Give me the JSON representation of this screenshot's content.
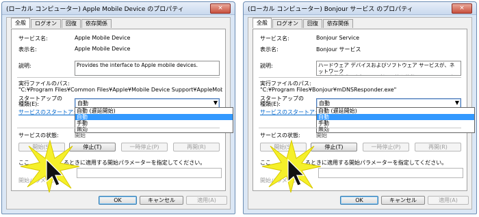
{
  "left": {
    "title": "(ローカル コンピューター) Apple Mobile Device のプロパティ",
    "close_label": "×",
    "tabs": [
      "全般",
      "ログオン",
      "回復",
      "依存関係"
    ],
    "service_name_label": "サービス名:",
    "service_name": "Apple Mobile Device",
    "display_name_label": "表示名:",
    "display_name": "Apple Mobile Device",
    "description_label": "説明:",
    "description": "Provides the interface to Apple mobile devices.",
    "exe_path_label": "実行ファイルのパス:",
    "exe_path": "\"C:¥Program Files¥Common Files¥Apple¥Mobile Device Support¥AppleMobileDev",
    "startup_type_label": "スタートアップの\n種類(E):",
    "startup_type_value": "自動",
    "startup_options": [
      "自動 (遅延開始)",
      "自動",
      "手動",
      "無効"
    ],
    "startup_selected_index": 1,
    "startup_help_link": "サービスのスタートアップ",
    "service_status_label": "サービスの状態:",
    "service_status_partial": "開始",
    "buttons": {
      "start": "開始(S)",
      "stop": "停止(T)",
      "pause": "一時停止(P)",
      "resume": "再開(R)"
    },
    "param_hint_prefix": "ここ",
    "param_hint": "るときに適用する開始パラメーターを指定してください。",
    "param_label": "開始パラメーター",
    "ok": "OK",
    "cancel": "キャンセル",
    "apply": "適用(A)"
  },
  "right": {
    "title": "(ローカル コンピューター) Bonjour サービス のプロパティ",
    "close_label": "×",
    "tabs": [
      "全般",
      "ログオン",
      "回復",
      "依存関係"
    ],
    "service_name_label": "サービス名:",
    "service_name": "Bonjour Service",
    "display_name_label": "表示名:",
    "display_name": "Bonjour サービス",
    "description_label": "説明:",
    "description": "ハードウェア デバイスおよびソフトウェア サービスが、ネットワーク\n上で自動構成を実行して、利用可能な状態であることを通知",
    "exe_path_label": "実行ファイルのパス:",
    "exe_path": "\"C:¥Program Files¥Bonjour¥mDNSResponder.exe\"",
    "startup_type_label": "スタートアップの\n種類(E):",
    "startup_type_value": "自動",
    "startup_options": [
      "自動 (遅延開始)",
      "自動",
      "手動",
      "無効"
    ],
    "startup_selected_index": 1,
    "startup_help_link": "サービスのスタートアップ",
    "service_status_label": "サービスの状態:",
    "service_status_partial": "開始",
    "buttons": {
      "start": "開始(S)",
      "stop": "停止(T)",
      "pause": "一時停止(P)",
      "resume": "再開(R)"
    },
    "param_hint_prefix": "ここ",
    "param_hint": "るときに適用する開始パラメーターを指定してください。",
    "param_label": "開始パラメーター",
    "ok": "OK",
    "cancel": "キャンセル",
    "apply": "適用(A)"
  },
  "colors": {
    "burst": "#f5f02a",
    "burst_stroke": "#d7c800",
    "selection": "#3399ff",
    "link": "#0066cc"
  },
  "icons": {
    "cursor": "arrow-cursor-icon",
    "close": "close-icon",
    "dropdown": "chevron-down-icon",
    "burst": "click-burst-icon"
  }
}
